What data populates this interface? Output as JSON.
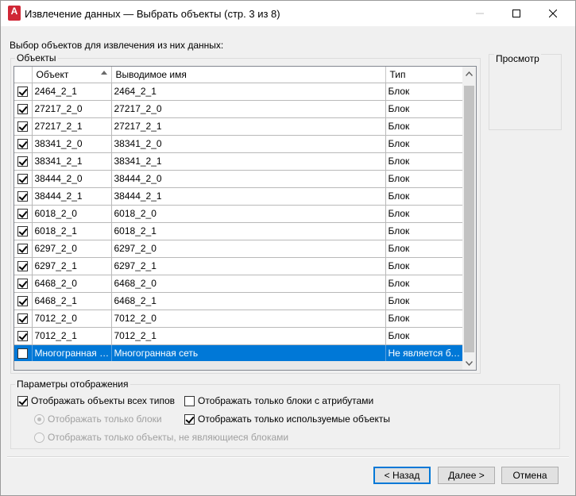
{
  "window": {
    "title": "Извлечение данных — Выбрать объекты (стр. 3 из 8)",
    "app_icon_letter": "A"
  },
  "instruction": "Выбор объектов для извлечения из них данных:",
  "objects_group": {
    "title": "Объекты"
  },
  "preview_group": {
    "title": "Просмотр"
  },
  "table": {
    "columns": [
      "Объект",
      "Выводимое имя",
      "Тип"
    ],
    "rows": [
      {
        "checked": true,
        "object": "2464_2_1",
        "display": "2464_2_1",
        "type": "Блок"
      },
      {
        "checked": true,
        "object": "27217_2_0",
        "display": "27217_2_0",
        "type": "Блок"
      },
      {
        "checked": true,
        "object": "27217_2_1",
        "display": "27217_2_1",
        "type": "Блок"
      },
      {
        "checked": true,
        "object": "38341_2_0",
        "display": "38341_2_0",
        "type": "Блок"
      },
      {
        "checked": true,
        "object": "38341_2_1",
        "display": "38341_2_1",
        "type": "Блок"
      },
      {
        "checked": true,
        "object": "38444_2_0",
        "display": "38444_2_0",
        "type": "Блок"
      },
      {
        "checked": true,
        "object": "38444_2_1",
        "display": "38444_2_1",
        "type": "Блок"
      },
      {
        "checked": true,
        "object": "6018_2_0",
        "display": "6018_2_0",
        "type": "Блок"
      },
      {
        "checked": true,
        "object": "6018_2_1",
        "display": "6018_2_1",
        "type": "Блок"
      },
      {
        "checked": true,
        "object": "6297_2_0",
        "display": "6297_2_0",
        "type": "Блок"
      },
      {
        "checked": true,
        "object": "6297_2_1",
        "display": "6297_2_1",
        "type": "Блок"
      },
      {
        "checked": true,
        "object": "6468_2_0",
        "display": "6468_2_0",
        "type": "Блок"
      },
      {
        "checked": true,
        "object": "6468_2_1",
        "display": "6468_2_1",
        "type": "Блок"
      },
      {
        "checked": true,
        "object": "7012_2_0",
        "display": "7012_2_0",
        "type": "Блок"
      },
      {
        "checked": true,
        "object": "7012_2_1",
        "display": "7012_2_1",
        "type": "Блок"
      },
      {
        "checked": false,
        "object": "Многогранная с...",
        "display": "Многогранная сеть",
        "type": "Не является бл...",
        "selected": true
      }
    ]
  },
  "display_options": {
    "title": "Параметры отображения",
    "show_all_types": {
      "label": "Отображать объекты всех типов",
      "checked": true
    },
    "only_blocks": {
      "label": "Отображать только блоки",
      "selected": true,
      "enabled": false
    },
    "only_non_blocks": {
      "label": "Отображать только объекты, не являющиеся блоками",
      "selected": false,
      "enabled": false
    },
    "only_blocks_with_attrs": {
      "label": "Отображать только блоки с атрибутами",
      "checked": false
    },
    "only_used": {
      "label": "Отображать только используемые объекты",
      "checked": true
    }
  },
  "buttons": {
    "back": "< Назад",
    "next": "Далее >",
    "cancel": "Отмена"
  },
  "colors": {
    "selection": "#0078d7",
    "app_icon": "#d02736"
  }
}
